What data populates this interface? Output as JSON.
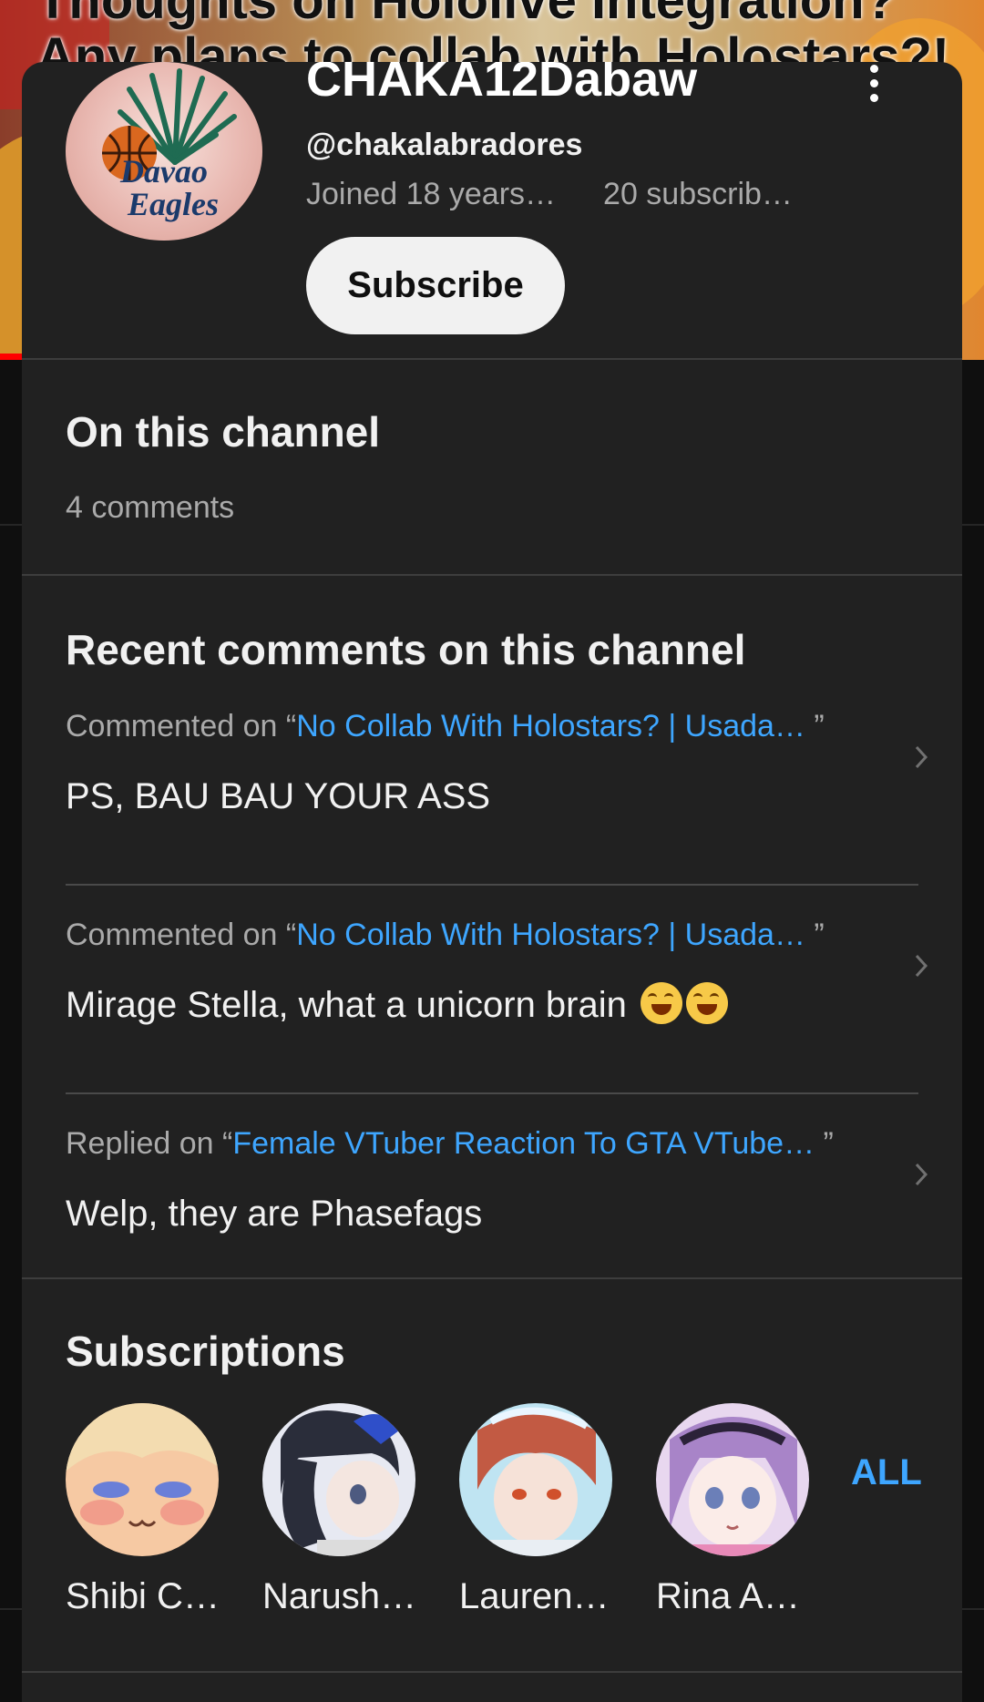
{
  "background": {
    "video_title_line1": "Thoughts on Hololive Integration?",
    "video_title_line2": "Any plans to collab with Holostars?!"
  },
  "header": {
    "channel_name": "CHAKA12Dabaw",
    "handle": "@chakalabradores",
    "joined": "Joined 18 years…",
    "subscribers": "20 subscrib…",
    "subscribe_label": "Subscribe",
    "avatar_text_line1": "Davao",
    "avatar_text_line2": "Eagles"
  },
  "on_channel": {
    "title": "On this channel",
    "count": "4 comments"
  },
  "recent": {
    "title": "Recent comments on this channel",
    "comments": [
      {
        "prefix": "Commented on “",
        "video": "No Collab With Holostars? | Usada…",
        "suffix": " ”",
        "text": "PS, BAU BAU YOUR ASS"
      },
      {
        "prefix": "Commented on “",
        "video": "No Collab With Holostars? | Usada…",
        "suffix": " ”",
        "text": "Mirage Stella, what a unicorn brain"
      },
      {
        "prefix": "Replied on “",
        "video": "Female VTuber Reaction To GTA VTube…",
        "suffix": " ”",
        "text": "Welp, they are Phasefags"
      }
    ]
  },
  "subscriptions": {
    "title": "Subscriptions",
    "all_label": "ALL",
    "items": [
      {
        "name": "Shibi C…"
      },
      {
        "name": "Narush…"
      },
      {
        "name": "Lauren…"
      },
      {
        "name": "Rina A…"
      }
    ]
  },
  "colors": {
    "sheet_bg": "#212121",
    "link_blue": "#3ea6ff",
    "secondary_text": "#aaaaaa"
  }
}
